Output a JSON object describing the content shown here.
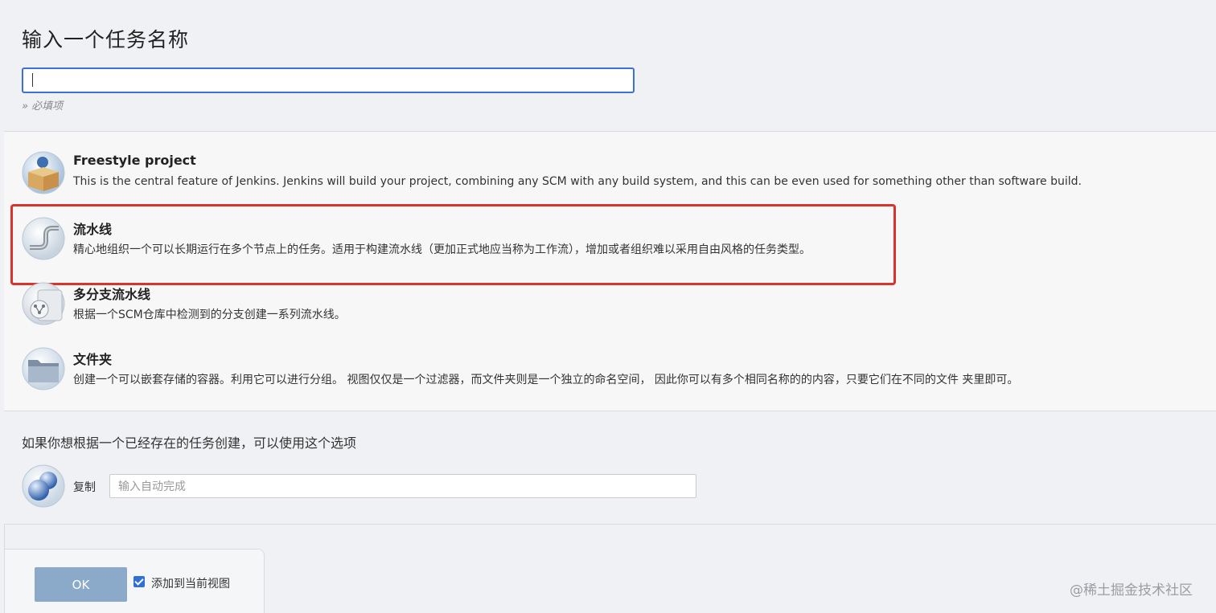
{
  "name_section": {
    "title": "输入一个任务名称",
    "input_value": "",
    "required_hint": "» 必填项"
  },
  "job_types": [
    {
      "title": "Freestyle project",
      "description": "This is the central feature of Jenkins. Jenkins will build your project, combining any SCM with any build system, and this can be even used for something other than software build.",
      "icon": "freestyle-box-icon"
    },
    {
      "title": "流水线",
      "description": "精心地组织一个可以长期运行在多个节点上的任务。适用于构建流水线（更加正式地应当称为工作流），增加或者组织难以采用自由风格的任务类型。",
      "icon": "pipeline-icon",
      "highlighted": true
    },
    {
      "title": "多分支流水线",
      "description": "根据一个SCM仓库中检测到的分支创建一系列流水线。",
      "icon": "multibranch-pipeline-icon"
    },
    {
      "title": "文件夹",
      "description": "创建一个可以嵌套存储的容器。利用它可以进行分组。 视图仅仅是一个过滤器，而文件夹则是一个独立的命名空间， 因此你可以有多个相同名称的的内容，只要它们在不同的文件 夹里即可。",
      "icon": "folder-icon"
    }
  ],
  "copy_section": {
    "hint": "如果你想根据一个已经存在的任务创建，可以使用这个选项",
    "label": "复制",
    "placeholder": "输入自动完成",
    "icon": "copy-spheres-icon"
  },
  "footer": {
    "ok_label": "OK",
    "add_to_view_label": "添加到当前视图",
    "add_to_view_checked": true
  },
  "watermark": "@稀土掘金技术社区",
  "colors": {
    "highlight": "#d9332e",
    "input_focus": "#3c6fd8",
    "ok_button": "#8ba9c9",
    "checkbox": "#2f6fd6"
  }
}
